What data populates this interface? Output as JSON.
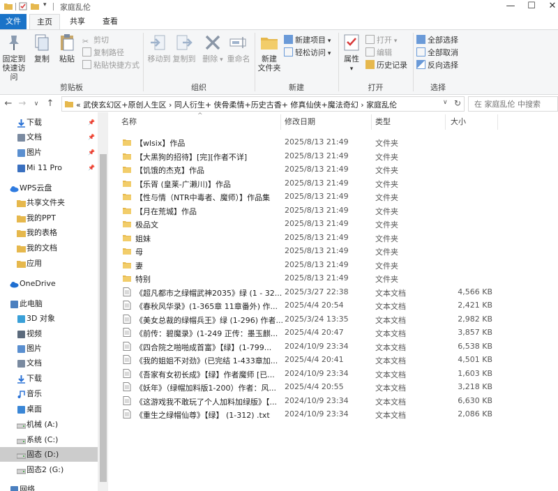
{
  "window": {
    "title": "家庭乱伦",
    "controls": [
      "minimize",
      "maximize",
      "close"
    ]
  },
  "ribbon_tabs": [
    "文件",
    "主页",
    "共享",
    "查看"
  ],
  "ribbon": {
    "clipboard": {
      "label": "剪贴板",
      "pin": "固定到\n快速访问",
      "pin_line1": "固定到",
      "pin_line2": "快速访问",
      "copy": "复制",
      "paste": "粘贴",
      "cut": "剪切",
      "copy_path": "复制路径",
      "paste_shortcut": "粘贴快捷方式"
    },
    "organize": {
      "label": "组织",
      "move_to": "移动到",
      "copy_to": "复制到",
      "delete": "删除",
      "rename": "重命名"
    },
    "new": {
      "label": "新建",
      "new_folder_line1": "新建",
      "new_folder_line2": "文件夹",
      "new_item": "新建项目",
      "easy_access": "轻松访问"
    },
    "open": {
      "label": "打开",
      "properties": "属性",
      "open": "打开",
      "edit": "编辑",
      "history": "历史记录"
    },
    "select": {
      "label": "选择",
      "select_all": "全部选择",
      "select_none": "全部取消",
      "invert": "反向选择"
    }
  },
  "address": {
    "path": "«  武侠玄幻区+原创人生区  ›  同人衍生+ 侠骨柔情+历史古香+ 修真仙侠+魔法奇幻  ›  家庭乱伦",
    "search_placeholder": "在 家庭乱伦 中搜索"
  },
  "nav": [
    {
      "label": "下载",
      "icon": "download-icon",
      "color": "#2a72d6",
      "pinned": true,
      "indent": 24
    },
    {
      "label": "文档",
      "icon": "document-icon",
      "color": "#7a8aa0",
      "pinned": true,
      "indent": 24
    },
    {
      "label": "图片",
      "icon": "picture-icon",
      "color": "#5a8fd0",
      "pinned": true,
      "indent": 24
    },
    {
      "label": "Mi 11 Pro",
      "icon": "phone-icon",
      "color": "#3a70c0",
      "pinned": true,
      "indent": 24
    },
    {
      "label": "WPS云盘",
      "icon": "cloud-icon",
      "color": "#2f7be0",
      "pinned": false,
      "indent": 14
    },
    {
      "label": "共享文件夹",
      "icon": "folder-icon",
      "color": "#e6b84d",
      "pinned": false,
      "indent": 24
    },
    {
      "label": "我的PPT",
      "icon": "folder-icon",
      "color": "#e6b84d",
      "pinned": false,
      "indent": 24
    },
    {
      "label": "我的表格",
      "icon": "folder-icon",
      "color": "#e6b84d",
      "pinned": false,
      "indent": 24
    },
    {
      "label": "我的文档",
      "icon": "folder-icon",
      "color": "#e6b84d",
      "pinned": false,
      "indent": 24
    },
    {
      "label": "应用",
      "icon": "folder-icon",
      "color": "#e6b84d",
      "pinned": false,
      "indent": 24
    },
    {
      "label": "OneDrive",
      "icon": "onedrive-icon",
      "color": "#1f6fd1",
      "pinned": false,
      "indent": 14
    },
    {
      "label": "此电脑",
      "icon": "computer-icon",
      "color": "#4a7fbf",
      "pinned": false,
      "indent": 14
    },
    {
      "label": "3D 对象",
      "icon": "cube-icon",
      "color": "#3aa0d8",
      "pinned": false,
      "indent": 24
    },
    {
      "label": "视频",
      "icon": "video-icon",
      "color": "#5b6a7c",
      "pinned": false,
      "indent": 24
    },
    {
      "label": "图片",
      "icon": "picture-icon",
      "color": "#5a8fd0",
      "pinned": false,
      "indent": 24
    },
    {
      "label": "文档",
      "icon": "document-icon",
      "color": "#7a8aa0",
      "pinned": false,
      "indent": 24
    },
    {
      "label": "下载",
      "icon": "download-icon",
      "color": "#2a72d6",
      "pinned": false,
      "indent": 24
    },
    {
      "label": "音乐",
      "icon": "music-icon",
      "color": "#2a72d6",
      "pinned": false,
      "indent": 24
    },
    {
      "label": "桌面",
      "icon": "desktop-icon",
      "color": "#3a86d6",
      "pinned": false,
      "indent": 24
    },
    {
      "label": "机械 (A:)",
      "icon": "drive-icon",
      "color": "#888",
      "pinned": false,
      "indent": 24
    },
    {
      "label": "系统 (C:)",
      "icon": "drive-icon",
      "color": "#888",
      "pinned": false,
      "indent": 24
    },
    {
      "label": "固态 (D:)",
      "icon": "drive-icon",
      "color": "#888",
      "pinned": false,
      "indent": 24,
      "selected": true
    },
    {
      "label": "固态2 (G:)",
      "icon": "drive-icon",
      "color": "#888",
      "pinned": false,
      "indent": 24
    },
    {
      "label": "网络",
      "icon": "network-icon",
      "color": "#4a7fbf",
      "pinned": false,
      "indent": 14
    }
  ],
  "columns": {
    "name": "名称",
    "date": "修改日期",
    "type": "类型",
    "size": "大小"
  },
  "files": [
    {
      "name": "【wlsix】作品",
      "date": "2025/8/13 21:49",
      "type": "文件夹",
      "size": "",
      "kind": "folder"
    },
    {
      "name": "【大黑狗的招待】[完][作者不详]",
      "date": "2025/8/13 21:49",
      "type": "文件夹",
      "size": "",
      "kind": "folder"
    },
    {
      "name": "【饥饿的杰克】作品",
      "date": "2025/8/13 21:49",
      "type": "文件夹",
      "size": "",
      "kind": "folder"
    },
    {
      "name": "【乐胥 (皇莱-广濑川)】作品",
      "date": "2025/8/13 21:49",
      "type": "文件夹",
      "size": "",
      "kind": "folder"
    },
    {
      "name": "【性与情（NTR中毒者、魔师）】作品集",
      "date": "2025/8/13 21:49",
      "type": "文件夹",
      "size": "",
      "kind": "folder"
    },
    {
      "name": "【月在荒城】作品",
      "date": "2025/8/13 21:49",
      "type": "文件夹",
      "size": "",
      "kind": "folder"
    },
    {
      "name": "极品文",
      "date": "2025/8/13 21:49",
      "type": "文件夹",
      "size": "",
      "kind": "folder"
    },
    {
      "name": "姐妹",
      "date": "2025/8/13 21:49",
      "type": "文件夹",
      "size": "",
      "kind": "folder"
    },
    {
      "name": "母",
      "date": "2025/8/13 21:49",
      "type": "文件夹",
      "size": "",
      "kind": "folder"
    },
    {
      "name": "妻",
      "date": "2025/8/13 21:49",
      "type": "文件夹",
      "size": "",
      "kind": "folder"
    },
    {
      "name": "特别",
      "date": "2025/8/13 21:49",
      "type": "文件夹",
      "size": "",
      "kind": "folder"
    },
    {
      "name": "《超凡都市之绿帽武神2035》绿 (1 - 32...",
      "date": "2025/3/27 22:38",
      "type": "文本文档",
      "size": "4,566 KB",
      "kind": "text"
    },
    {
      "name": "《春秋风华录》(1-365章 11章番外) 作...",
      "date": "2025/4/4 20:54",
      "type": "文本文档",
      "size": "2,421 KB",
      "kind": "text"
    },
    {
      "name": "《美女总裁的绿帽兵王》绿 (1-296) 作者...",
      "date": "2025/3/24 13:35",
      "type": "文本文档",
      "size": "2,982 KB",
      "kind": "text"
    },
    {
      "name": "《前传：碧魔录》(1-249 正传：墨玉麒...",
      "date": "2025/4/4 20:47",
      "type": "文本文档",
      "size": "3,857 KB",
      "kind": "text"
    },
    {
      "name": "《四合院之啪啪成首富》【绿】(1-799...",
      "date": "2024/10/9 23:34",
      "type": "文本文档",
      "size": "6,538 KB",
      "kind": "text"
    },
    {
      "name": "《我的姐姐不对劲》(已完结 1-433章加...",
      "date": "2025/4/4 20:41",
      "type": "文本文档",
      "size": "4,501 KB",
      "kind": "text"
    },
    {
      "name": "《吾家有女初长成》【绿】作者魔师 [已...",
      "date": "2024/10/9 23:34",
      "type": "文本文档",
      "size": "1,603 KB",
      "kind": "text"
    },
    {
      "name": "《妖年》（绿帽加料版1-200）作者：风...",
      "date": "2025/4/4 20:55",
      "type": "文本文档",
      "size": "3,218 KB",
      "kind": "text"
    },
    {
      "name": "《这游戏我不敢玩了个人加料加绿版》【...",
      "date": "2024/10/9 23:34",
      "type": "文本文档",
      "size": "6,630 KB",
      "kind": "text"
    },
    {
      "name": "《重生之绿帽仙尊》【绿】 (1-312) .txt",
      "date": "2024/10/9 23:34",
      "type": "文本文档",
      "size": "2,086 KB",
      "kind": "text"
    }
  ]
}
